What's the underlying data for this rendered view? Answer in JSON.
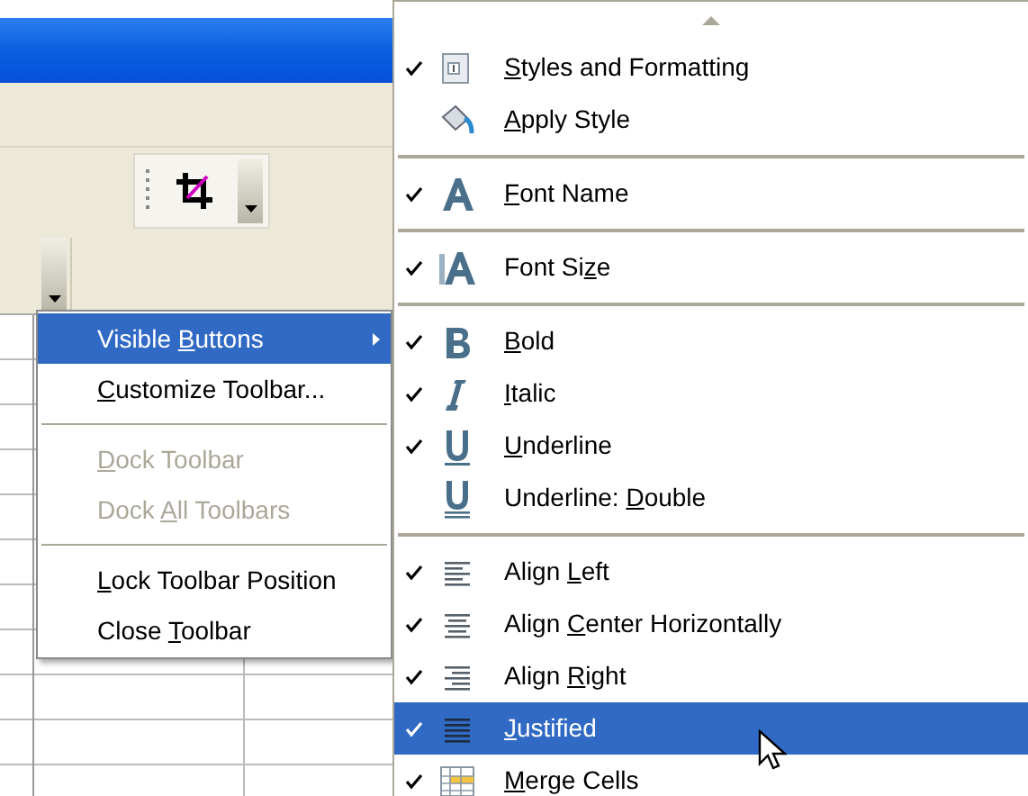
{
  "context_menu": {
    "groups": [
      [
        {
          "label": {
            "pre": "Visible ",
            "key": "B",
            "post": "uttons"
          },
          "selected": true,
          "disabled": false,
          "has_submenu": true
        },
        {
          "label": {
            "key": "C",
            "post": "ustomize Toolbar..."
          },
          "selected": false,
          "disabled": false,
          "has_submenu": false
        }
      ],
      [
        {
          "label": {
            "key": "D",
            "post": "ock Toolbar"
          },
          "selected": false,
          "disabled": true,
          "has_submenu": false
        },
        {
          "label": {
            "pre": "Dock ",
            "key": "A",
            "post": "ll Toolbars"
          },
          "selected": false,
          "disabled": true,
          "has_submenu": false
        }
      ],
      [
        {
          "label": {
            "key": "L",
            "post": "ock Toolbar Position"
          },
          "selected": false,
          "disabled": false,
          "has_submenu": false
        },
        {
          "label": {
            "pre": "Close ",
            "key": "T",
            "post": "oolbar"
          },
          "selected": false,
          "disabled": false,
          "has_submenu": false
        }
      ]
    ]
  },
  "buttons_menu": {
    "groups": [
      [
        {
          "label": {
            "key": "S",
            "post": "tyles and Formatting"
          },
          "checked": true,
          "selected": false
        },
        {
          "label": {
            "key": "A",
            "post": "pply Style"
          },
          "checked": false,
          "selected": false
        }
      ],
      [
        {
          "label": {
            "key": "F",
            "post": "ont Name"
          },
          "checked": true,
          "selected": false
        }
      ],
      [
        {
          "label": {
            "pre": "Font Si",
            "key": "z",
            "post": "e"
          },
          "checked": true,
          "selected": false
        }
      ],
      [
        {
          "label": {
            "key": "B",
            "post": "old"
          },
          "checked": true,
          "selected": false
        },
        {
          "label": {
            "key": "I",
            "post": "talic"
          },
          "checked": true,
          "selected": false
        },
        {
          "label": {
            "key": "U",
            "post": "nderline"
          },
          "checked": true,
          "selected": false
        },
        {
          "label": {
            "pre": "Underline: ",
            "key": "D",
            "post": "ouble"
          },
          "checked": false,
          "selected": false
        }
      ],
      [
        {
          "label": {
            "pre": "Align ",
            "key": "L",
            "post": "eft"
          },
          "checked": true,
          "selected": false
        },
        {
          "label": {
            "pre": "Align ",
            "key": "C",
            "post": "enter Horizontally"
          },
          "checked": true,
          "selected": false
        },
        {
          "label": {
            "pre": "Align ",
            "key": "R",
            "post": "ight"
          },
          "checked": true,
          "selected": false
        },
        {
          "label": {
            "key": "J",
            "post": "ustified"
          },
          "checked": true,
          "selected": true
        },
        {
          "label": {
            "key": "M",
            "post": "erge Cells"
          },
          "checked": true,
          "selected": false
        }
      ]
    ]
  }
}
